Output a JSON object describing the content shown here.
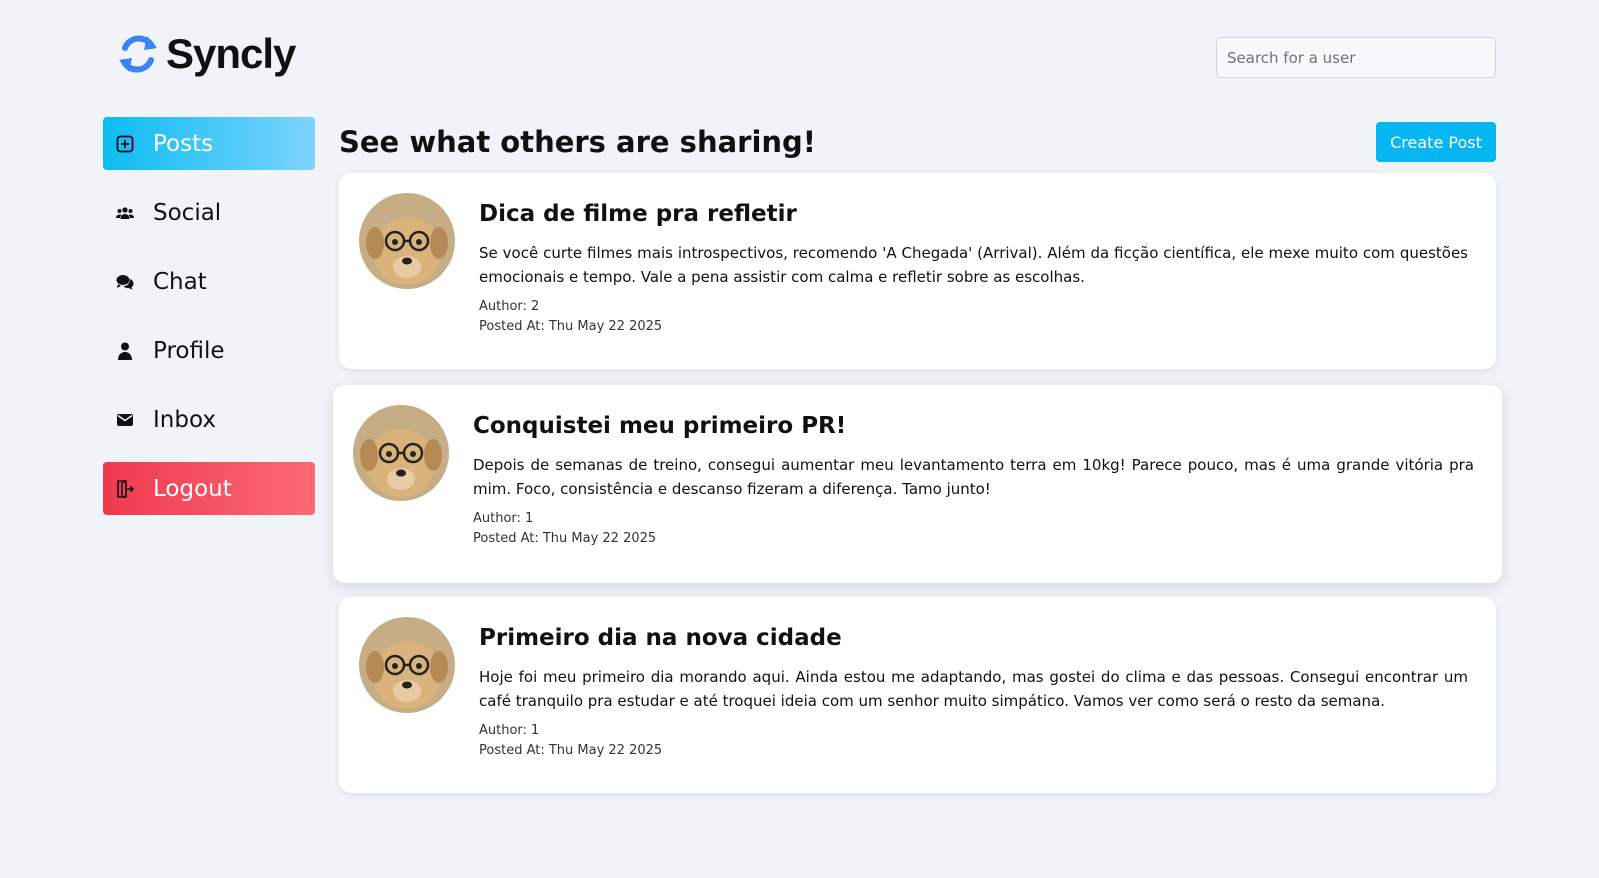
{
  "brand": {
    "name": "Syncly",
    "accent": "#3b82f6"
  },
  "search": {
    "placeholder": "Search for a user",
    "value": ""
  },
  "sidebar": {
    "items": [
      {
        "label": "Posts",
        "icon": "plus-square-icon",
        "active": true
      },
      {
        "label": "Social",
        "icon": "users-icon",
        "active": false
      },
      {
        "label": "Chat",
        "icon": "chat-bubbles-icon",
        "active": false
      },
      {
        "label": "Profile",
        "icon": "person-icon",
        "active": false
      },
      {
        "label": "Inbox",
        "icon": "envelope-icon",
        "active": false
      },
      {
        "label": "Logout",
        "icon": "door-exit-icon",
        "active": false
      }
    ]
  },
  "main": {
    "title": "See what others are sharing!",
    "create_label": "Create Post"
  },
  "posts": [
    {
      "title": "Dica de filme pra refletir",
      "body": "Se você curte filmes mais introspectivos, recomendo 'A Chegada' (Arrival). Além da ficção científica, ele mexe muito com questões emocionais e tempo. Vale a pena assistir com calma e refletir sobre as escolhas.",
      "author": "Author: 2",
      "posted_at": "Posted At: Thu May 22 2025"
    },
    {
      "title": "Conquistei meu primeiro PR!",
      "body": "Depois de semanas de treino, consegui aumentar meu levantamento terra em 10kg! Parece pouco, mas é uma grande vitória pra mim. Foco, consistência e descanso fizeram a diferença. Tamo junto!",
      "author": "Author: 1",
      "posted_at": "Posted At: Thu May 22 2025"
    },
    {
      "title": "Primeiro dia na nova cidade",
      "body": "Hoje foi meu primeiro dia morando aqui. Ainda estou me adaptando, mas gostei do clima e das pessoas. Consegui encontrar um café tranquilo pra estudar e até troquei ideia com um senhor muito simpático. Vamos ver como será o resto da semana.",
      "author": "Author: 1",
      "posted_at": "Posted At: Thu May 22 2025"
    }
  ]
}
